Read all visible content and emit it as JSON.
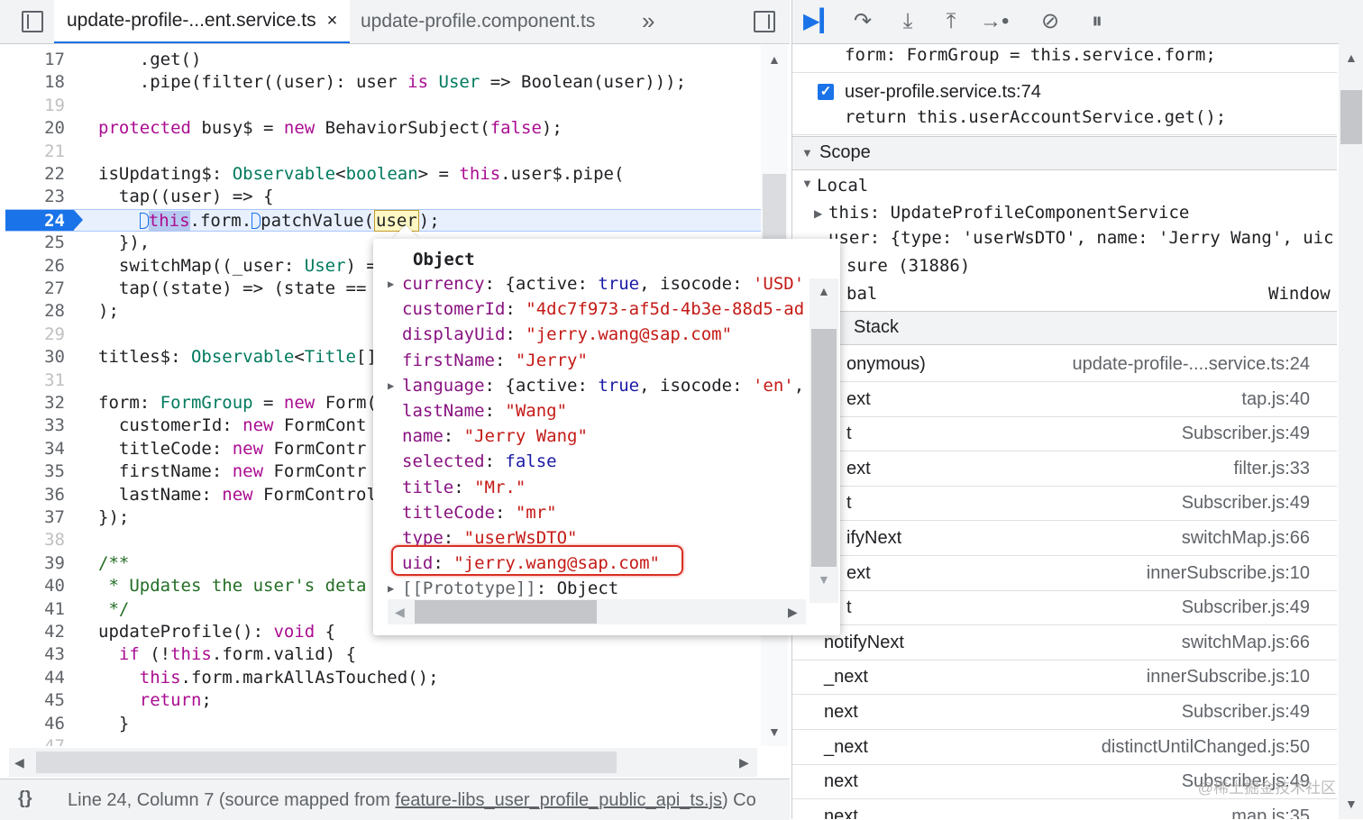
{
  "editor": {
    "tabs": [
      {
        "label": "update-profile-...ent.service.ts",
        "close": "×"
      },
      {
        "label": "update-profile.component.ts"
      }
    ],
    "more_tabs": "»",
    "lines": [
      {
        "n": "17",
        "text": "    .get()"
      },
      {
        "n": "18",
        "text": "    .pipe(filter((user): user is User => Boolean(user)));"
      },
      {
        "n": "19",
        "text": ""
      },
      {
        "n": "20",
        "text": "protected busy$ = new BehaviorSubject(false);"
      },
      {
        "n": "21",
        "text": ""
      },
      {
        "n": "22",
        "text": "isUpdating$: Observable<boolean> = this.user$.pipe("
      },
      {
        "n": "23",
        "text": "  tap((user) => {"
      },
      {
        "n": "24",
        "text": "    this.form.patchValue(user);"
      },
      {
        "n": "25",
        "text": "  }),"
      },
      {
        "n": "26",
        "text": "  switchMap((_user: User) ="
      },
      {
        "n": "27",
        "text": "  tap((state) => (state =="
      },
      {
        "n": "28",
        "text": ");"
      },
      {
        "n": "29",
        "text": ""
      },
      {
        "n": "30",
        "text": "titles$: Observable<Title[]"
      },
      {
        "n": "31",
        "text": ""
      },
      {
        "n": "32",
        "text": "form: FormGroup = new Form("
      },
      {
        "n": "33",
        "text": "  customerId: new FormCont"
      },
      {
        "n": "34",
        "text": "  titleCode: new FormContr"
      },
      {
        "n": "35",
        "text": "  firstName: new FormContr"
      },
      {
        "n": "36",
        "text": "  lastName: new FormControl"
      },
      {
        "n": "37",
        "text": "});"
      },
      {
        "n": "38",
        "text": ""
      },
      {
        "n": "39",
        "text": "/**"
      },
      {
        "n": "40",
        "text": " * Updates the user's deta"
      },
      {
        "n": "41",
        "text": " */"
      },
      {
        "n": "42",
        "text": "updateProfile(): void {"
      },
      {
        "n": "43",
        "text": "  if (!this.form.valid) {"
      },
      {
        "n": "44",
        "text": "    this.form.markAllAsTouched();"
      },
      {
        "n": "45",
        "text": "    return;"
      },
      {
        "n": "46",
        "text": "  }"
      },
      {
        "n": "47",
        "text": ""
      }
    ],
    "status": {
      "braces": "{}",
      "prefix": "Line 24, Column 7  (source mapped from ",
      "link": "feature-libs_user_profile_public_api_ts.js",
      "suffix": ")  Co"
    }
  },
  "popover": {
    "title": "Object",
    "props": [
      {
        "key": "currency",
        "value": "{active: true, isocode: 'USD'",
        "expandable": true
      },
      {
        "key": "customerId",
        "value": "\"4dc7f973-af5d-4b3e-88d5-ad"
      },
      {
        "key": "displayUid",
        "value": "\"jerry.wang@sap.com\""
      },
      {
        "key": "firstName",
        "value": "\"Jerry\""
      },
      {
        "key": "language",
        "value": "{active: true, isocode: 'en',",
        "expandable": true
      },
      {
        "key": "lastName",
        "value": "\"Wang\""
      },
      {
        "key": "name",
        "value": "\"Jerry Wang\""
      },
      {
        "key": "selected",
        "value": "false"
      },
      {
        "key": "title",
        "value": "\"Mr.\""
      },
      {
        "key": "titleCode",
        "value": "\"mr\""
      },
      {
        "key": "type",
        "value": "\"userWsDTO\""
      },
      {
        "key": "uid",
        "value": "\"jerry.wang@sap.com\""
      },
      {
        "key": "[[Prototype]]",
        "value": "Object",
        "expandable": true
      }
    ]
  },
  "debugger": {
    "toolbar_icons": [
      "resume-icon",
      "step-over-icon",
      "step-into-icon",
      "step-out-icon",
      "step-icon",
      "deactivate-breakpoints-icon",
      "pause-on-exceptions-icon"
    ],
    "snippet_top": "form: FormGroup = this.service.form;",
    "breakpoint_file": "user-profile.service.ts:74",
    "breakpoint_code": "return this.userAccountService.get();",
    "scope_title": "Scope",
    "local_title": "Local",
    "this_line": "this: UpdateProfileComponentService",
    "user_line": "user: {type: 'userWsDTO', name: 'Jerry Wang', uic",
    "closure_line": "sure (31886)",
    "global_label": "bal",
    "global_value": "Window",
    "stack_title": "Stack",
    "stack": [
      {
        "fn": "onymous)",
        "loc": "update-profile-....service.ts:24"
      },
      {
        "fn": "ext",
        "loc": "tap.js:40"
      },
      {
        "fn": "t",
        "loc": "Subscriber.js:49"
      },
      {
        "fn": "ext",
        "loc": "filter.js:33"
      },
      {
        "fn": "t",
        "loc": "Subscriber.js:49"
      },
      {
        "fn": "ifyNext",
        "loc": "switchMap.js:66"
      },
      {
        "fn": "ext",
        "loc": "innerSubscribe.js:10"
      },
      {
        "fn": "t",
        "loc": "Subscriber.js:49"
      },
      {
        "fn": "notifyNext",
        "loc": "switchMap.js:66"
      },
      {
        "fn": "_next",
        "loc": "innerSubscribe.js:10"
      },
      {
        "fn": "next",
        "loc": "Subscriber.js:49"
      },
      {
        "fn": "_next",
        "loc": "distinctUntilChanged.js:50"
      },
      {
        "fn": "next",
        "loc": "Subscriber.js:49"
      },
      {
        "fn": "next",
        "loc": "map.js:35"
      }
    ],
    "watermark": "@稀土掘金技术社区"
  },
  "colors": {
    "accent": "#1a73e8",
    "highlight_box": "#d93025",
    "keyword": "#aa0d91",
    "string": "#c41a16"
  }
}
